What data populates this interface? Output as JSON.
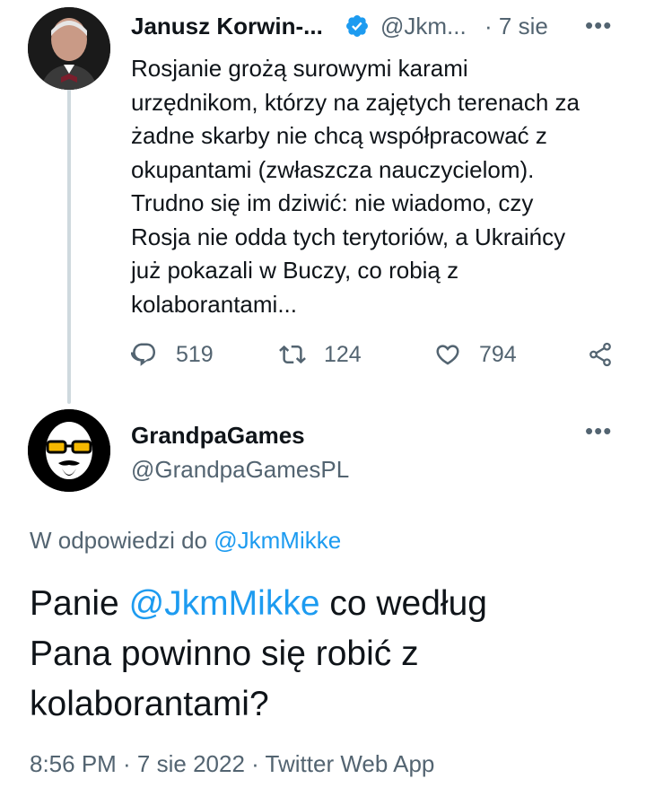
{
  "tweet1": {
    "author_name": "Janusz Korwin-...",
    "handle": "@Jkm...",
    "separator": "·",
    "time": "7 sie",
    "more_label": "•••",
    "text_lines": [
      "Rosjanie grożą surowymi karami",
      "urzędnikom, którzy na zajętych terenach za",
      "żadne skarby nie chcą współpracować z",
      "okupantami (zwłaszcza nauczycielom).",
      "Trudno się im dziwić: nie wiadomo, czy",
      "Rosja nie odda tych terytoriów, a Ukraińcy",
      "już pokazali w Buczy, co robią z",
      "kolaborantami..."
    ],
    "replies": "519",
    "retweets": "124",
    "likes": "794"
  },
  "tweet2": {
    "author_name": "GrandpaGames",
    "handle": "@GrandpaGamesPL",
    "more_label": "•••",
    "reply_prefix": "W odpowiedzi do ",
    "reply_to": "@JkmMikke",
    "text_line1_prefix": "Panie ",
    "text_mention": "@JkmMikke",
    "text_line1_suffix": " co według",
    "text_line2": "Pana powinno się robić z",
    "text_line3": "kolaborantami?",
    "meta": "8:56 PM · 7 sie 2022 · Twitter Web App"
  },
  "colors": {
    "accent": "#1d9bf0",
    "muted": "#536471",
    "text": "#0f1419",
    "thread_line": "#cfd9de"
  },
  "icons": [
    "verified-badge-icon",
    "reply-icon",
    "retweet-icon",
    "like-icon",
    "share-icon",
    "more-icon"
  ]
}
